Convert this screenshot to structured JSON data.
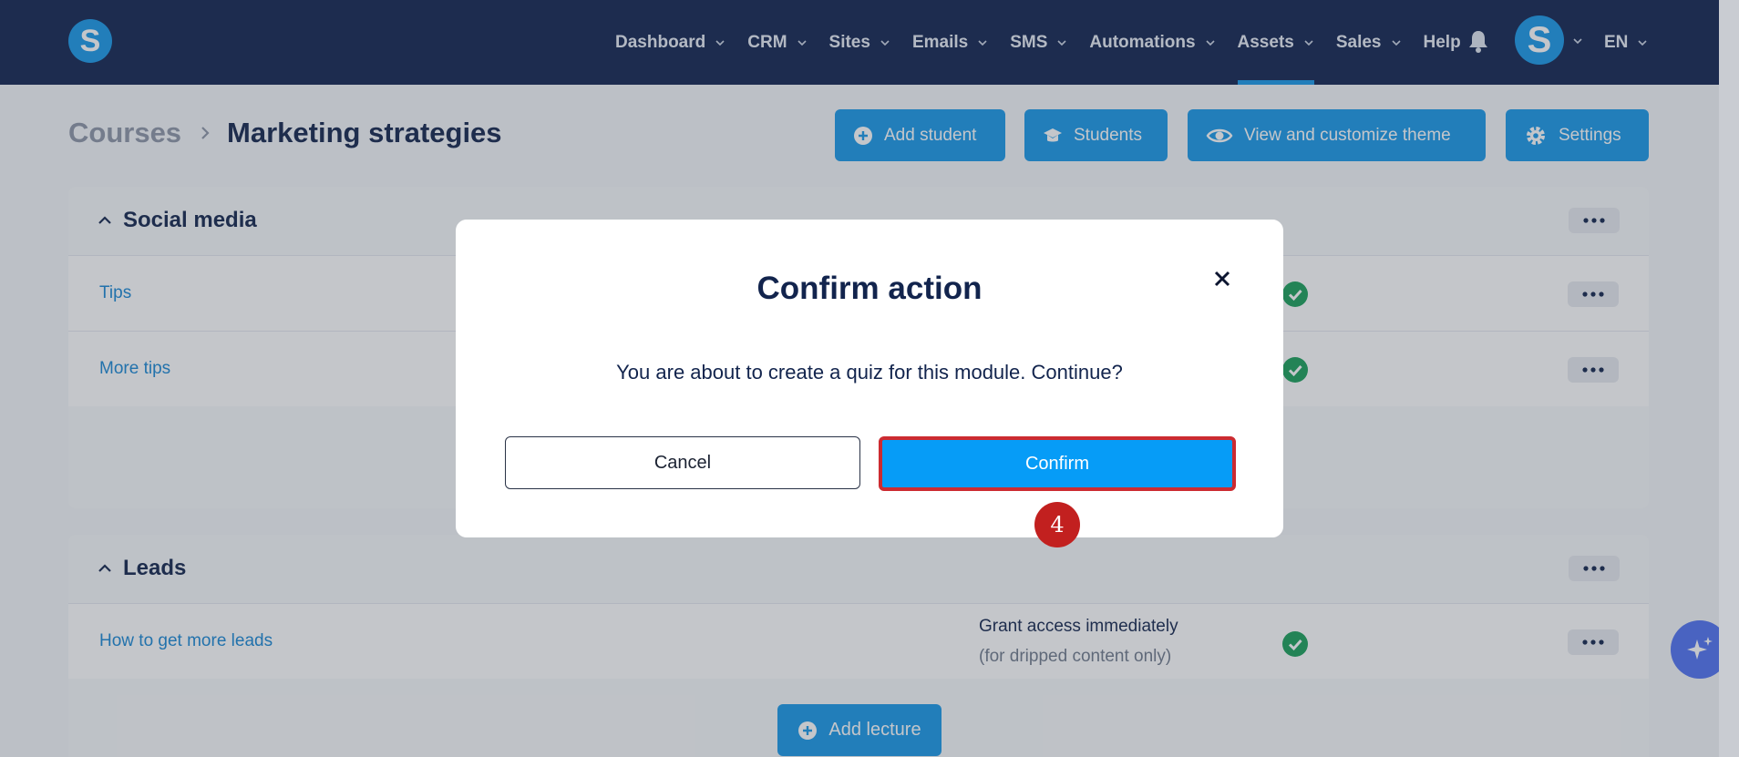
{
  "nav": {
    "logo": "S",
    "items": [
      {
        "label": "Dashboard",
        "dropdown": true
      },
      {
        "label": "CRM",
        "dropdown": true
      },
      {
        "label": "Sites",
        "dropdown": true
      },
      {
        "label": "Emails",
        "dropdown": true
      },
      {
        "label": "SMS",
        "dropdown": true
      },
      {
        "label": "Automations",
        "dropdown": true
      },
      {
        "label": "Assets",
        "dropdown": true,
        "active": true
      },
      {
        "label": "Sales",
        "dropdown": true
      },
      {
        "label": "Help",
        "dropdown": false
      }
    ],
    "avatar": "S",
    "language": "EN"
  },
  "header": {
    "breadcrumb_root": "Courses",
    "breadcrumb_current": "Marketing strategies",
    "buttons": {
      "add_student": "Add student",
      "students": "Students",
      "theme": "View and customize theme",
      "settings": "Settings"
    }
  },
  "sections": {
    "social": {
      "title": "Social media",
      "lectures": [
        "Tips",
        "More tips"
      ]
    },
    "leads": {
      "title": "Leads",
      "lectures": [
        "How to get more leads"
      ],
      "grant": "Grant access immediately",
      "grant_sub": "(for dripped content only)",
      "add_lecture": "Add lecture"
    }
  },
  "modal": {
    "title": "Confirm action",
    "message": "You are about to create a quiz for this module. Continue?",
    "cancel": "Cancel",
    "confirm": "Confirm"
  },
  "step_badge": "4",
  "colors": {
    "nav_bg": "#11234f",
    "accent": "#1798e9",
    "confirm_bg": "#069cf7",
    "highlight": "#cc2b31",
    "success": "#19a05a"
  }
}
